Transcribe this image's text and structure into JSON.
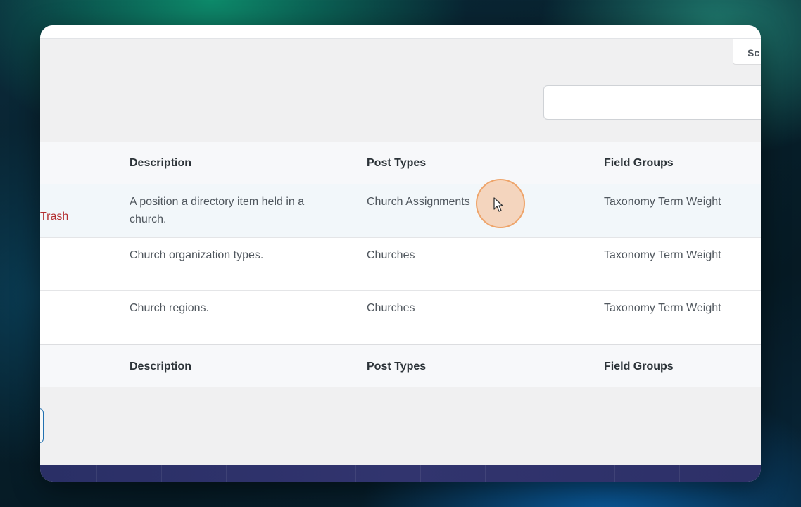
{
  "toolbar": {
    "screen_options_label": "Sc"
  },
  "search": {
    "value": ""
  },
  "table": {
    "headers": {
      "description": "Description",
      "post_types": "Post Types",
      "field_groups": "Field Groups"
    },
    "rows": [
      {
        "trash_label": "Trash",
        "description": "A position a directory item held in a church.",
        "post_types": "Church Assignments",
        "field_groups": "Taxonomy Term Weight"
      },
      {
        "description": "Church organization types.",
        "post_types": "Churches",
        "field_groups": "Taxonomy Term Weight"
      },
      {
        "description": "Church regions.",
        "post_types": "Churches",
        "field_groups": "Taxonomy Term Weight"
      }
    ],
    "footer_headers": {
      "description": "Description",
      "post_types": "Post Types",
      "field_groups": "Field Groups"
    }
  },
  "cursor": {
    "icon": "mouse-pointer-icon",
    "highlight_color": "#eea46a"
  }
}
